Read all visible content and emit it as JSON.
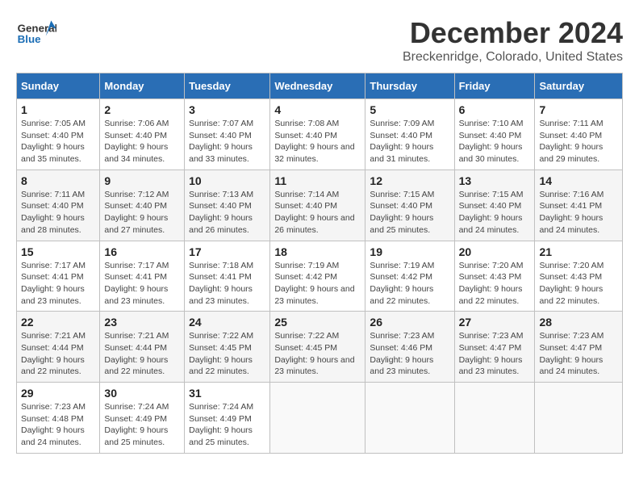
{
  "header": {
    "logo_general": "General",
    "logo_blue": "Blue",
    "title": "December 2024",
    "subtitle": "Breckenridge, Colorado, United States"
  },
  "columns": [
    "Sunday",
    "Monday",
    "Tuesday",
    "Wednesday",
    "Thursday",
    "Friday",
    "Saturday"
  ],
  "weeks": [
    [
      {
        "day": "1",
        "sunrise": "Sunrise: 7:05 AM",
        "sunset": "Sunset: 4:40 PM",
        "daylight": "Daylight: 9 hours and 35 minutes."
      },
      {
        "day": "2",
        "sunrise": "Sunrise: 7:06 AM",
        "sunset": "Sunset: 4:40 PM",
        "daylight": "Daylight: 9 hours and 34 minutes."
      },
      {
        "day": "3",
        "sunrise": "Sunrise: 7:07 AM",
        "sunset": "Sunset: 4:40 PM",
        "daylight": "Daylight: 9 hours and 33 minutes."
      },
      {
        "day": "4",
        "sunrise": "Sunrise: 7:08 AM",
        "sunset": "Sunset: 4:40 PM",
        "daylight": "Daylight: 9 hours and 32 minutes."
      },
      {
        "day": "5",
        "sunrise": "Sunrise: 7:09 AM",
        "sunset": "Sunset: 4:40 PM",
        "daylight": "Daylight: 9 hours and 31 minutes."
      },
      {
        "day": "6",
        "sunrise": "Sunrise: 7:10 AM",
        "sunset": "Sunset: 4:40 PM",
        "daylight": "Daylight: 9 hours and 30 minutes."
      },
      {
        "day": "7",
        "sunrise": "Sunrise: 7:11 AM",
        "sunset": "Sunset: 4:40 PM",
        "daylight": "Daylight: 9 hours and 29 minutes."
      }
    ],
    [
      {
        "day": "8",
        "sunrise": "Sunrise: 7:11 AM",
        "sunset": "Sunset: 4:40 PM",
        "daylight": "Daylight: 9 hours and 28 minutes."
      },
      {
        "day": "9",
        "sunrise": "Sunrise: 7:12 AM",
        "sunset": "Sunset: 4:40 PM",
        "daylight": "Daylight: 9 hours and 27 minutes."
      },
      {
        "day": "10",
        "sunrise": "Sunrise: 7:13 AM",
        "sunset": "Sunset: 4:40 PM",
        "daylight": "Daylight: 9 hours and 26 minutes."
      },
      {
        "day": "11",
        "sunrise": "Sunrise: 7:14 AM",
        "sunset": "Sunset: 4:40 PM",
        "daylight": "Daylight: 9 hours and 26 minutes."
      },
      {
        "day": "12",
        "sunrise": "Sunrise: 7:15 AM",
        "sunset": "Sunset: 4:40 PM",
        "daylight": "Daylight: 9 hours and 25 minutes."
      },
      {
        "day": "13",
        "sunrise": "Sunrise: 7:15 AM",
        "sunset": "Sunset: 4:40 PM",
        "daylight": "Daylight: 9 hours and 24 minutes."
      },
      {
        "day": "14",
        "sunrise": "Sunrise: 7:16 AM",
        "sunset": "Sunset: 4:41 PM",
        "daylight": "Daylight: 9 hours and 24 minutes."
      }
    ],
    [
      {
        "day": "15",
        "sunrise": "Sunrise: 7:17 AM",
        "sunset": "Sunset: 4:41 PM",
        "daylight": "Daylight: 9 hours and 23 minutes."
      },
      {
        "day": "16",
        "sunrise": "Sunrise: 7:17 AM",
        "sunset": "Sunset: 4:41 PM",
        "daylight": "Daylight: 9 hours and 23 minutes."
      },
      {
        "day": "17",
        "sunrise": "Sunrise: 7:18 AM",
        "sunset": "Sunset: 4:41 PM",
        "daylight": "Daylight: 9 hours and 23 minutes."
      },
      {
        "day": "18",
        "sunrise": "Sunrise: 7:19 AM",
        "sunset": "Sunset: 4:42 PM",
        "daylight": "Daylight: 9 hours and 23 minutes."
      },
      {
        "day": "19",
        "sunrise": "Sunrise: 7:19 AM",
        "sunset": "Sunset: 4:42 PM",
        "daylight": "Daylight: 9 hours and 22 minutes."
      },
      {
        "day": "20",
        "sunrise": "Sunrise: 7:20 AM",
        "sunset": "Sunset: 4:43 PM",
        "daylight": "Daylight: 9 hours and 22 minutes."
      },
      {
        "day": "21",
        "sunrise": "Sunrise: 7:20 AM",
        "sunset": "Sunset: 4:43 PM",
        "daylight": "Daylight: 9 hours and 22 minutes."
      }
    ],
    [
      {
        "day": "22",
        "sunrise": "Sunrise: 7:21 AM",
        "sunset": "Sunset: 4:44 PM",
        "daylight": "Daylight: 9 hours and 22 minutes."
      },
      {
        "day": "23",
        "sunrise": "Sunrise: 7:21 AM",
        "sunset": "Sunset: 4:44 PM",
        "daylight": "Daylight: 9 hours and 22 minutes."
      },
      {
        "day": "24",
        "sunrise": "Sunrise: 7:22 AM",
        "sunset": "Sunset: 4:45 PM",
        "daylight": "Daylight: 9 hours and 22 minutes."
      },
      {
        "day": "25",
        "sunrise": "Sunrise: 7:22 AM",
        "sunset": "Sunset: 4:45 PM",
        "daylight": "Daylight: 9 hours and 23 minutes."
      },
      {
        "day": "26",
        "sunrise": "Sunrise: 7:23 AM",
        "sunset": "Sunset: 4:46 PM",
        "daylight": "Daylight: 9 hours and 23 minutes."
      },
      {
        "day": "27",
        "sunrise": "Sunrise: 7:23 AM",
        "sunset": "Sunset: 4:47 PM",
        "daylight": "Daylight: 9 hours and 23 minutes."
      },
      {
        "day": "28",
        "sunrise": "Sunrise: 7:23 AM",
        "sunset": "Sunset: 4:47 PM",
        "daylight": "Daylight: 9 hours and 24 minutes."
      }
    ],
    [
      {
        "day": "29",
        "sunrise": "Sunrise: 7:23 AM",
        "sunset": "Sunset: 4:48 PM",
        "daylight": "Daylight: 9 hours and 24 minutes."
      },
      {
        "day": "30",
        "sunrise": "Sunrise: 7:24 AM",
        "sunset": "Sunset: 4:49 PM",
        "daylight": "Daylight: 9 hours and 25 minutes."
      },
      {
        "day": "31",
        "sunrise": "Sunrise: 7:24 AM",
        "sunset": "Sunset: 4:49 PM",
        "daylight": "Daylight: 9 hours and 25 minutes."
      },
      null,
      null,
      null,
      null
    ]
  ]
}
